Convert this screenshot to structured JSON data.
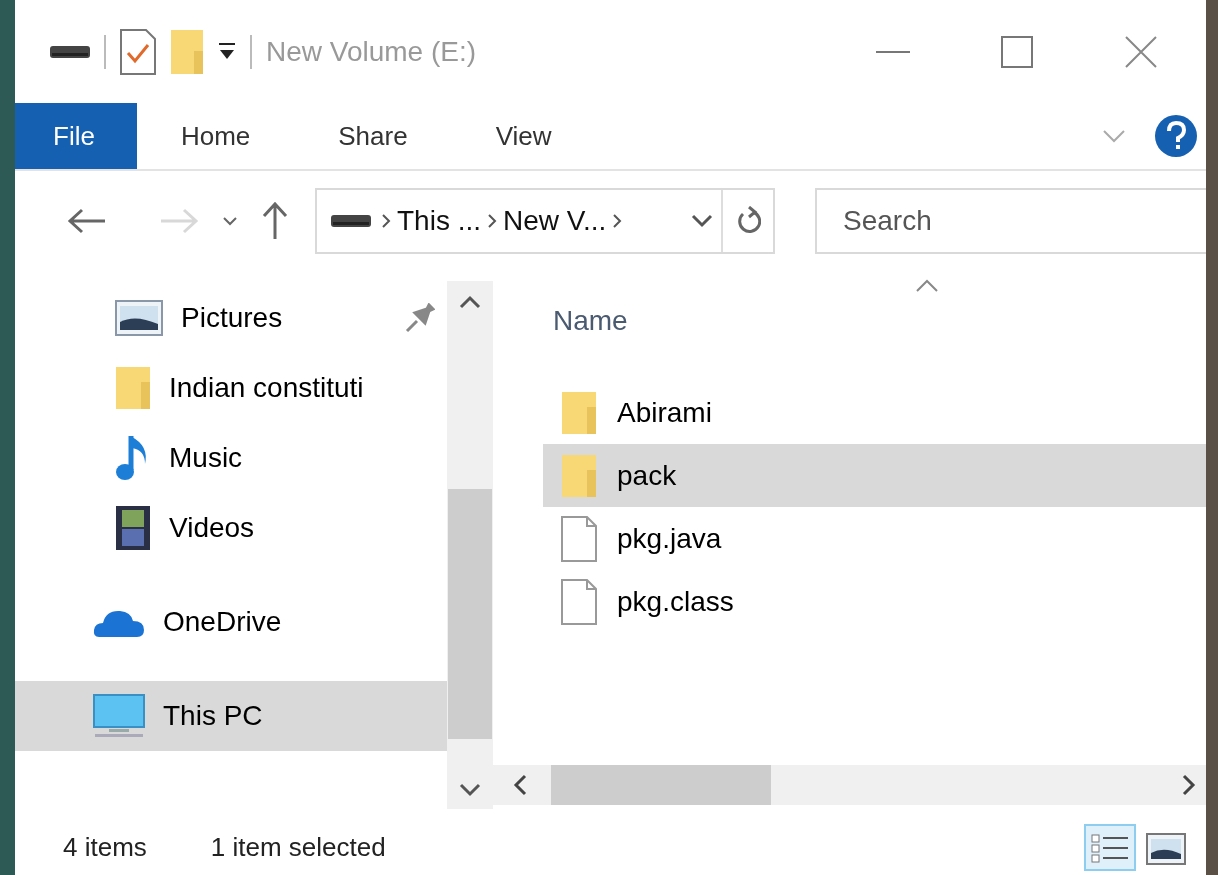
{
  "window": {
    "title": "New Volume (E:)"
  },
  "ribbon": {
    "tabs": [
      {
        "label": "File",
        "selected": true
      },
      {
        "label": "Home",
        "selected": false
      },
      {
        "label": "Share",
        "selected": false
      },
      {
        "label": "View",
        "selected": false
      }
    ]
  },
  "nav_buttons": [
    {
      "kind": "back",
      "disabled": false
    },
    {
      "kind": "forward",
      "disabled": true
    },
    {
      "kind": "recent",
      "disabled": false
    },
    {
      "kind": "up",
      "disabled": false
    }
  ],
  "address": {
    "crumbs": [
      "This ...",
      "New V..."
    ]
  },
  "search": {
    "placeholder": "Search"
  },
  "nav": {
    "items": [
      {
        "label": "Pictures",
        "kind": "pictures",
        "pinned": true,
        "selected": false
      },
      {
        "label": "Indian constituti",
        "kind": "folder",
        "pinned": false,
        "selected": false
      },
      {
        "label": "Music",
        "kind": "music",
        "pinned": false,
        "selected": false
      },
      {
        "label": "Videos",
        "kind": "videos",
        "pinned": false,
        "selected": false
      },
      {
        "label": "OneDrive",
        "kind": "cloud",
        "pinned": false,
        "selected": false
      },
      {
        "label": "This PC",
        "kind": "pc",
        "pinned": false,
        "selected": true
      }
    ]
  },
  "list": {
    "columns": [
      "Name"
    ],
    "items": [
      {
        "name": "Abirami",
        "kind": "folder",
        "selected": false
      },
      {
        "name": "pack",
        "kind": "folder",
        "selected": true
      },
      {
        "name": "pkg.java",
        "kind": "file",
        "selected": false
      },
      {
        "name": "pkg.class",
        "kind": "file",
        "selected": false
      }
    ]
  },
  "status": {
    "count": "4 items",
    "selection": "1 item selected"
  },
  "views": [
    {
      "kind": "details",
      "selected": true
    },
    {
      "kind": "tiles",
      "selected": false
    }
  ]
}
